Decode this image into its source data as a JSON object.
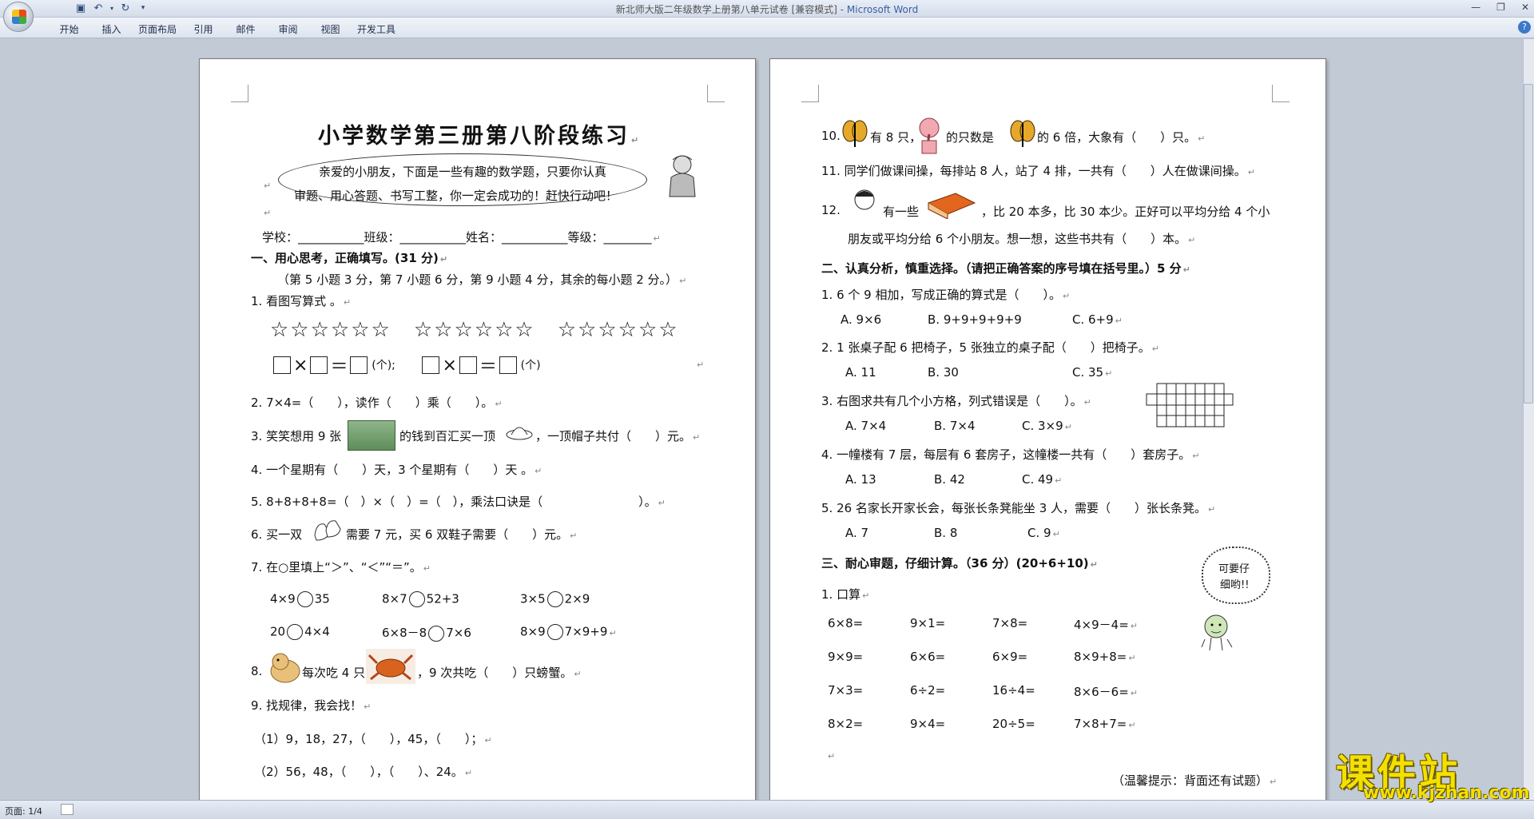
{
  "window": {
    "title": "新北师大版二年级数学上册第八单元试卷 [兼容模式]",
    "app": " - Microsoft Word"
  },
  "ribbon": {
    "tabs": [
      "开始",
      "插入",
      "页面布局",
      "引用",
      "邮件",
      "审阅",
      "视图",
      "开发工具"
    ]
  },
  "status": {
    "page": "页面: 1/4"
  },
  "watermark": {
    "text": "课件站",
    "url": "www.kjzhan.com"
  },
  "page1": {
    "title": "小学数学第三册第八阶段练习",
    "bubble_l1": "亲爱的小朋友，下面是一些有趣的数学题，只要你认真",
    "bubble_l2": "审题、用心答题、书写工整，你一定会成功的！赶快行动吧！",
    "school": "学校：___________班级：___________姓名：___________等级：________",
    "sec1": "一、用心思考，正确填写。(31 分)",
    "sec1_note": "（第 5 小题 3 分，第 7 小题 6 分，第 9 小题 4 分，其余的每小题 2 分。）",
    "q1": "1. 看图写算式 。",
    "stars": "☆☆☆☆☆☆　☆☆☆☆☆☆　☆☆☆☆☆☆",
    "unit_a": "(个);",
    "unit_b": "(个)",
    "q2": "2. 7×4=（　　），读作（　　）乘（　　）。",
    "q3a": "3. 笑笑想用 9 张",
    "q3b": "的钱到百汇买一顶",
    "q3c": "，一顶帽子共付（　　）元。",
    "q4": "4. 一个星期有（　　）天，3 个星期有（　　）天 。",
    "q5": "5. 8+8+8+8=（　）×（　）=（　），乘法口诀是（　　　　　　　　）。",
    "q6a": "6. 买一双",
    "q6b": "需要 7 元，买 6 双鞋子需要（　　）元。",
    "q7": "7. 在○里填上“＞”、“＜”“＝”。",
    "cmp": [
      [
        "4×9",
        "35"
      ],
      [
        "8×7",
        "52+3"
      ],
      [
        "3×5",
        "2×9"
      ],
      [
        "20",
        "4×4"
      ],
      [
        "6×8－8",
        "7×6"
      ],
      [
        "8×9",
        "7×9+9"
      ]
    ],
    "q8a": "8.",
    "q8b": "每次吃 4 只",
    "q8c": "，9 次共吃（　　）只螃蟹。",
    "q9": "9. 找规律，我会找！",
    "q9_1": "（1）9，18，27，（　　），45，（　　）；",
    "q9_2": "（2）56，48，（　　），（　　）、24。"
  },
  "page2": {
    "q10a": "10.",
    "q10b": "有 8 只，",
    "q10c": "的只数是",
    "q10d": "的 6 倍，大象有（　　）只。",
    "q11": "11. 同学们做课间操，每排站 8 人，站了 4 排，一共有（　　）人在做课间操。",
    "q12a": "12.",
    "q12b": "有一些",
    "q12c": "，比 20 本多，比 30 本少。正好可以平均分给 4 个小",
    "q12d": "朋友或平均分给 6 个小朋友。想一想，这些书共有（　　）本。",
    "sec2": "二、认真分析，慎重选择。（请把正确答案的序号填在括号里。）5 分",
    "s2q1": "1. 6 个 9 相加，写成正确的算式是（　　）。",
    "s2q1o": [
      "A. 9×6",
      "B. 9+9+9+9+9",
      "C. 6+9"
    ],
    "s2q2": "2. 1 张桌子配 6 把椅子，5 张独立的桌子配（　　）把椅子。",
    "s2q2o": [
      "A. 11",
      "B. 30",
      "C. 35"
    ],
    "s2q3": "3. 右图求共有几个小方格，列式错误是（　　）。",
    "s2q3o": [
      "A. 7×4",
      "B. 7×4",
      "C. 3×9"
    ],
    "s2q4": "4. 一幢楼有 7 层，每层有 6 套房子，这幢楼一共有（　　）套房子。",
    "s2q4o": [
      "A. 13",
      "B. 42",
      "C. 49"
    ],
    "s2q5": "5. 26 名家长开家长会，每张长条凳能坐 3 人，需要（　　）张长条凳。",
    "s2q5o": [
      "A. 7",
      "B. 8",
      "C. 9"
    ],
    "sec3": "三、耐心审题，仔细计算。（36 分）(20+6+10)",
    "cloud1": "可要仔",
    "cloud2": "细哟!!",
    "s3q1": "1. 口算",
    "calc": [
      [
        "6×8=",
        "9×1=",
        "7×8=",
        "4×9－4="
      ],
      [
        "9×9=",
        "6×6=",
        "6×9=",
        "8×9+8="
      ],
      [
        "7×3=",
        "6÷2=",
        "16÷4=",
        "8×6－6="
      ],
      [
        "8×2=",
        "9×4=",
        "20÷5=",
        "7×8+7="
      ]
    ],
    "hint": "（温馨提示：背面还有试题）"
  }
}
